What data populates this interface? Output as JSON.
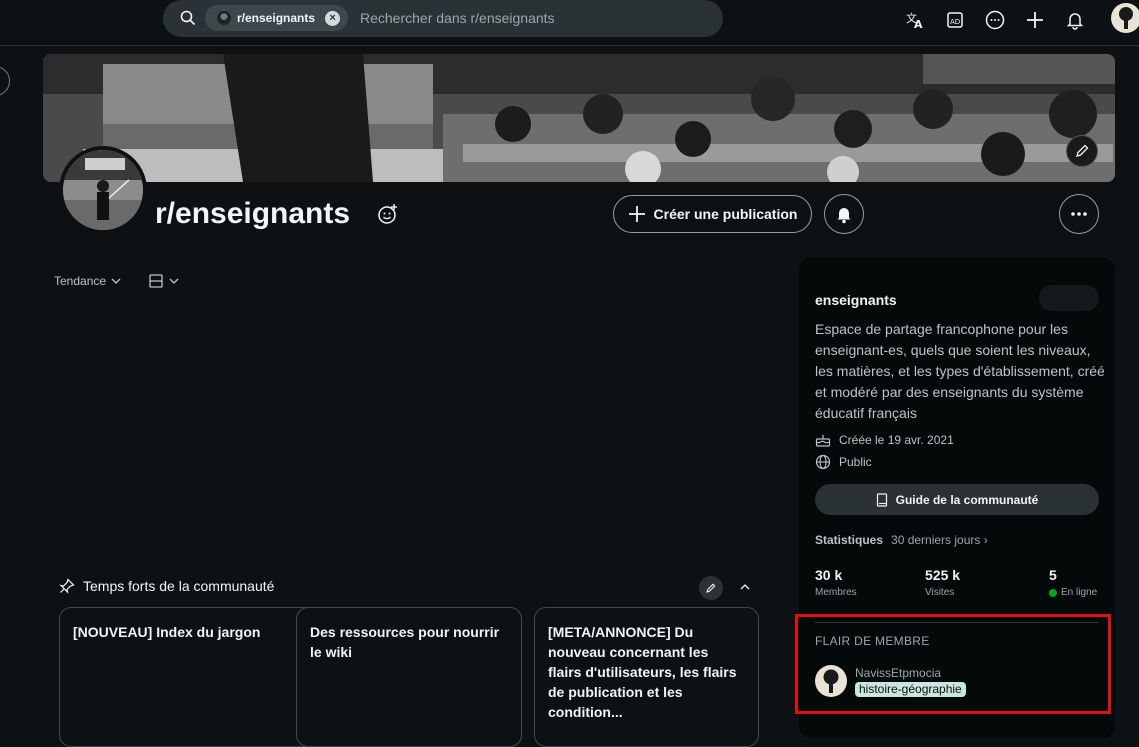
{
  "search": {
    "chip_label": "r/enseignants",
    "placeholder": "Rechercher dans r/enseignants"
  },
  "header_icons": [
    "translate-icon",
    "advertise-icon",
    "chat-icon",
    "create-icon",
    "notifications-icon"
  ],
  "community": {
    "title": "r/enseignants",
    "create_post_label": "Créer une publication"
  },
  "feed": {
    "sort_label": "Tendance"
  },
  "highlights": {
    "title": "Temps forts de la communauté",
    "cards": [
      {
        "text": "[NOUVEAU] Index du jargon"
      },
      {
        "text": "Des ressources pour nourrir le wiki"
      },
      {
        "text": "[META/ANNONCE] Du nouveau concernant les flairs d'utilisateurs, les flairs de publication et les condition..."
      }
    ]
  },
  "sidebar": {
    "name": "enseignants",
    "description": "Espace de partage francophone pour les enseignant-es, quels que soient les niveaux, les matières, et les types d'établissement, créé et modéré par des enseignants du système éducatif français",
    "created": "Créée le 19 avr. 2021",
    "visibility": "Public",
    "guide_label": "Guide de la communauté",
    "stats_label": "Statistiques",
    "stats_period": "30 derniers jours ›",
    "stats": [
      {
        "value": "30 k",
        "label": "Membres"
      },
      {
        "value": "525 k",
        "label": "Visites"
      },
      {
        "value": "5",
        "label": "En ligne"
      }
    ]
  },
  "flair": {
    "title": "FLAIR DE MEMBRE",
    "username": "NavissEtpmocia",
    "tag": "histoire-géographie",
    "tag_color": "#c9e7df"
  },
  "colors": {
    "background": "#0e1113",
    "sidebar": "#04090a",
    "highlight_border": "#e0101a",
    "online_dot": "#01a816"
  }
}
